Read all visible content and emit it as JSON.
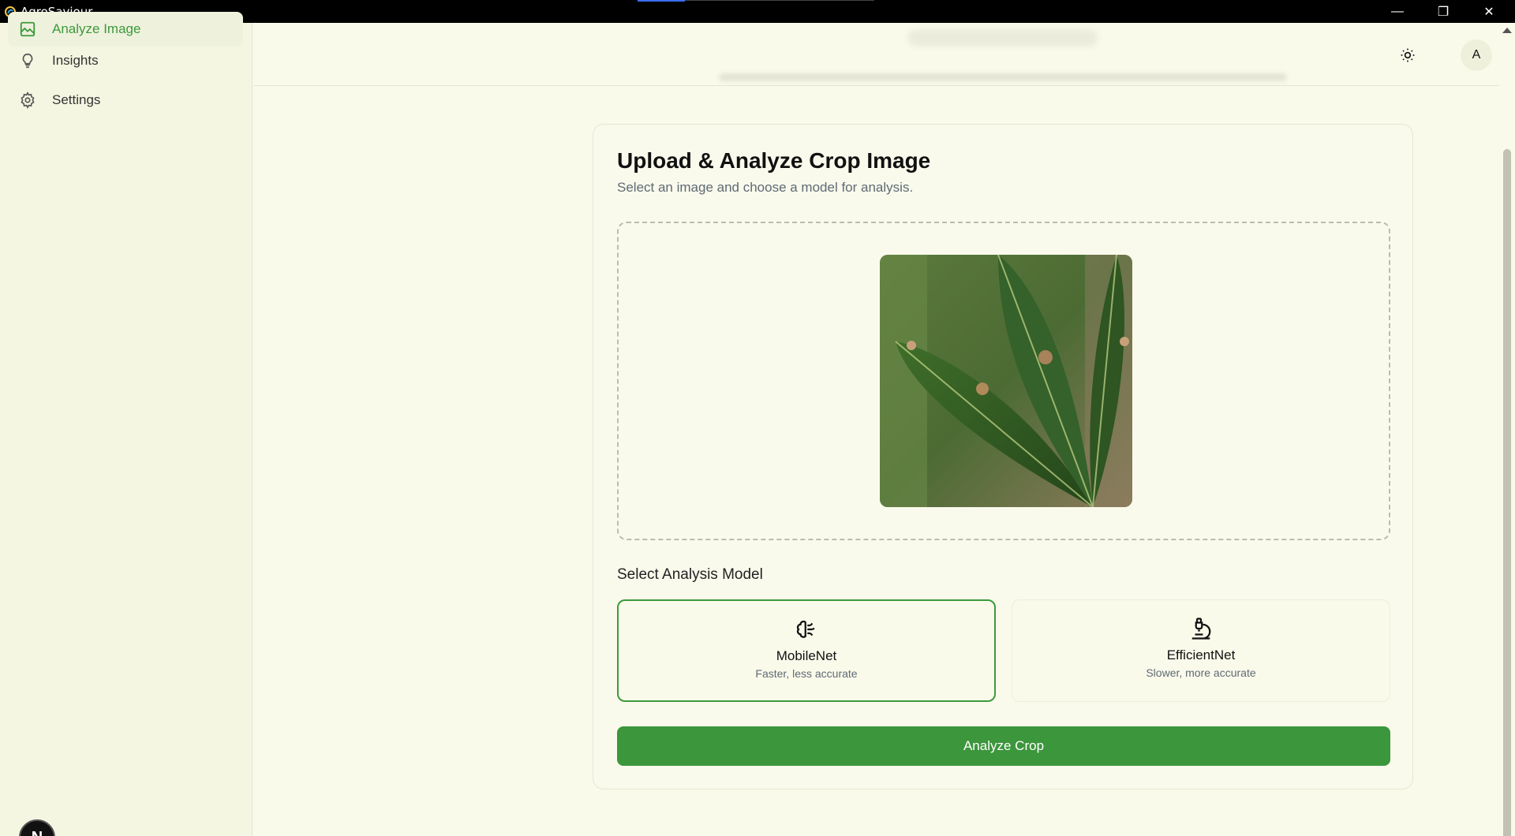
{
  "window": {
    "title": "AgroSaviour",
    "controls": {
      "minimize": "—",
      "maximize": "❐",
      "close": "✕"
    }
  },
  "sidebar": {
    "items": [
      {
        "label": "Analyze Image",
        "icon": "image-icon",
        "active": true
      },
      {
        "label": "Insights",
        "icon": "lightbulb-icon",
        "active": false
      },
      {
        "label": "Settings",
        "icon": "gear-icon",
        "active": false
      }
    ],
    "footer_avatar": "N"
  },
  "header": {
    "user_initial": "A",
    "theme_icon": "sun-icon"
  },
  "upload_card": {
    "title": "Upload & Analyze Crop Image",
    "subtitle": "Select an image and choose a model for analysis.",
    "section_label": "Select Analysis Model",
    "models": [
      {
        "name": "MobileNet",
        "description": "Faster, less accurate",
        "icon": "brain-icon",
        "selected": true
      },
      {
        "name": "EfficientNet",
        "description": "Slower, more accurate",
        "icon": "microscope-icon",
        "selected": false
      }
    ],
    "analyze_button": "Analyze Crop"
  },
  "colors": {
    "accent": "#3c963c",
    "background": "#fafaeb",
    "sidebar": "#f4f6e1"
  }
}
